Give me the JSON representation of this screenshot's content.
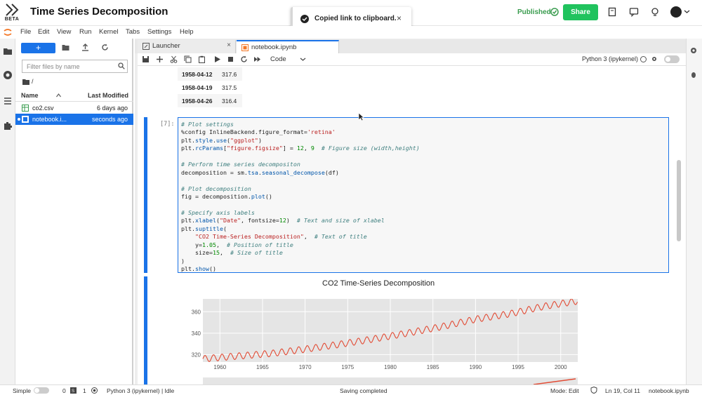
{
  "app": {
    "title": "Time Series Decomposition",
    "logo_badge": "BETA",
    "published_label": "Published",
    "share_label": "Share"
  },
  "toast": {
    "message": "Copied link to clipboard.",
    "close": "×"
  },
  "menubar": [
    "File",
    "Edit",
    "View",
    "Run",
    "Kernel",
    "Tabs",
    "Settings",
    "Help"
  ],
  "filebrowser": {
    "new_label": "+",
    "filter_placeholder": "Filter files by name",
    "breadcrumb": "/",
    "col_name": "Name",
    "col_modified": "Last Modified",
    "files": [
      {
        "name": "co2.csv",
        "modified": "6 days ago",
        "icon": "table-icon",
        "selected": false
      },
      {
        "name": "notebook.i...",
        "modified": "seconds ago",
        "icon": "notebook-icon",
        "selected": true
      }
    ]
  },
  "tabs": [
    {
      "label": "Launcher",
      "icon": "launcher-icon",
      "active": false
    },
    {
      "label": "notebook.ipynb",
      "icon": "notebook-icon",
      "active": true
    }
  ],
  "toolbar": {
    "cell_type": "Code",
    "kernel_name": "Python 3 (ipykernel)"
  },
  "output_table": [
    {
      "date": "1958-04-12",
      "value": "317.6"
    },
    {
      "date": "1958-04-19",
      "value": "317.5"
    },
    {
      "date": "1958-04-26",
      "value": "316.4"
    }
  ],
  "cell": {
    "prompt": "[7]:"
  },
  "chart_data": {
    "type": "line",
    "title": "CO2 Time-Series Decomposition",
    "xlabel": "",
    "ylabel": "",
    "x_ticks": [
      "1960",
      "1965",
      "1970",
      "1975",
      "1980",
      "1985",
      "1990",
      "1995",
      "2000"
    ],
    "y_ticks": [
      "320",
      "340",
      "360"
    ],
    "xlim": [
      1958,
      2002
    ],
    "ylim": [
      313,
      372
    ],
    "series": [
      {
        "values_start_year": 1958,
        "x": [
          1958,
          1962,
          1966,
          1970,
          1974,
          1978,
          1982,
          1986,
          1990,
          1994,
          1998,
          2002
        ],
        "y": [
          316,
          318.5,
          321,
          325,
          329.5,
          334.5,
          340,
          346,
          353,
          358,
          365,
          370
        ]
      }
    ],
    "line_color": "#e24a33",
    "grid": true
  },
  "statusbar": {
    "mode_simple": "Simple",
    "count_a": "0",
    "count_b": "1",
    "kernel_status": "Python 3 (ipykernel) | Idle",
    "saving": "Saving completed",
    "mode": "Mode: Edit",
    "position": "Ln 19, Col 11",
    "filename": "notebook.ipynb"
  }
}
